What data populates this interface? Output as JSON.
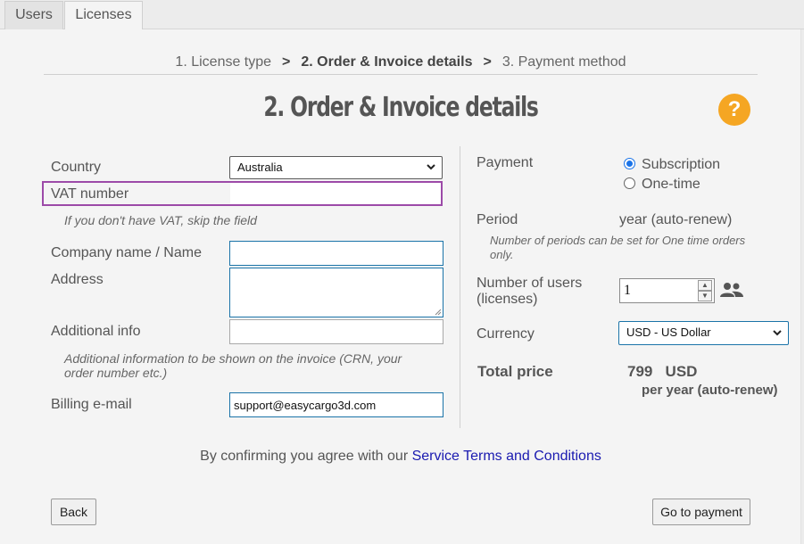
{
  "tabs": [
    {
      "label": "Users"
    },
    {
      "label": "Licenses"
    }
  ],
  "steps": {
    "step1": "1. License type",
    "sep": ">",
    "step2": "2. Order & Invoice details",
    "step3": "3. Payment method"
  },
  "title": "2. Order & Invoice details",
  "help_label": "?",
  "form": {
    "country": {
      "label": "Country",
      "value": "Australia"
    },
    "vat": {
      "label": "VAT number",
      "value": "",
      "hint": "If you don't have VAT, skip the field"
    },
    "company": {
      "label": "Company name / Name",
      "value": ""
    },
    "address": {
      "label": "Address",
      "value": ""
    },
    "additional": {
      "label": "Additional info",
      "value": "",
      "hint_line1": "Additional information to be shown on the invoice (CRN, your",
      "hint_line2": "order number etc.)"
    },
    "billing": {
      "label": "Billing e-mail",
      "value": "support@easycargo3d.com"
    }
  },
  "payment": {
    "label": "Payment",
    "options": [
      "Subscription",
      "One-time"
    ],
    "selected": "Subscription"
  },
  "period": {
    "label": "Period",
    "value": "year (auto-renew)",
    "hint_line1": "Number of periods can be set for One time orders",
    "hint_line2": "only."
  },
  "users": {
    "label_line1": "Number of users",
    "label_line2": "(licenses)",
    "value": "1"
  },
  "currency": {
    "label": "Currency",
    "value": "USD - US Dollar"
  },
  "total": {
    "label": "Total price",
    "amount": "799",
    "currency": "USD",
    "per": "per year (auto-renew)"
  },
  "terms": {
    "text": "By confirming you agree with our",
    "link": "Service Terms and Conditions"
  },
  "buttons": {
    "back": "Back",
    "go": "Go to payment"
  }
}
